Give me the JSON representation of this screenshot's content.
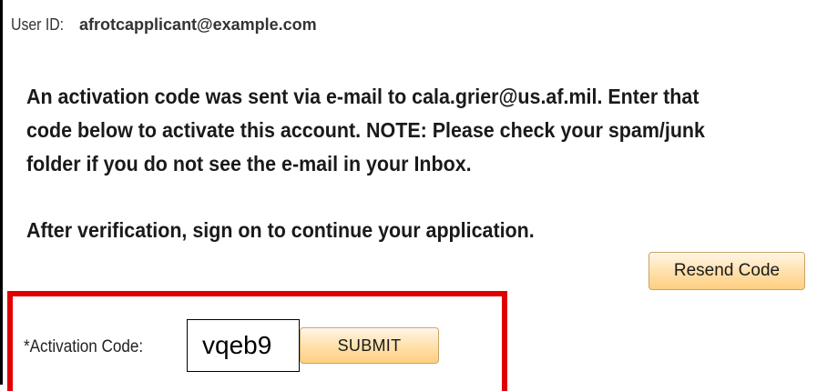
{
  "user": {
    "label": "User ID:",
    "value": "afrotcapplicant@example.com"
  },
  "message": {
    "lines": [
      "An activation code was sent via e-mail to cala.grier@us.af.mil.  Enter that",
      "code below to activate this account.  NOTE: Please check your spam/junk",
      "folder if you do not see the e-mail in your Inbox."
    ],
    "after": "After verification, sign on to continue your application."
  },
  "buttons": {
    "resend_label": "Resend Code",
    "submit_label": "SUBMIT"
  },
  "activation": {
    "label": "*Activation Code:",
    "value": "vqeb9"
  },
  "colors": {
    "highlight": "#e00000",
    "button_fill": "#ffe3b3",
    "button_border": "#c9a26a"
  }
}
